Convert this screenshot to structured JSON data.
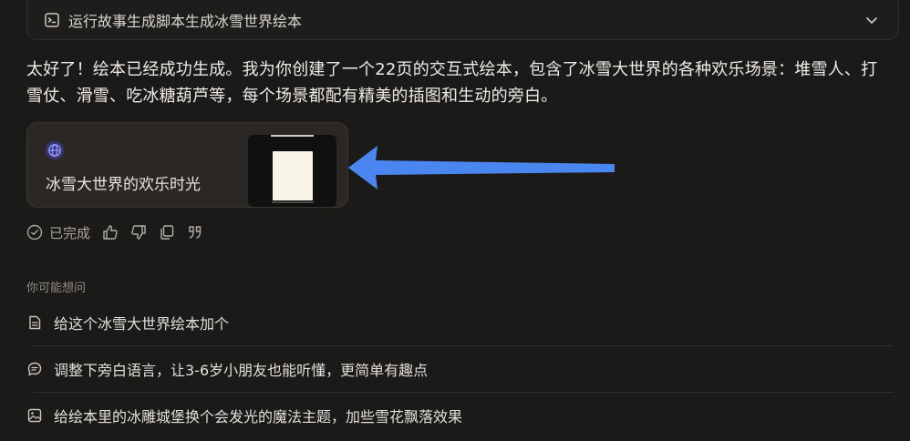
{
  "task": {
    "title": "运行故事生成脚本生成冰雪世界绘本",
    "icon": "terminal-icon",
    "toggle_icon": "chevron-down-icon"
  },
  "message": {
    "text": "太好了！绘本已经成功生成。我为你创建了一个22页的交互式绘本，包含了冰雪大世界的各种欢乐场景：堆雪人、打雪仗、滑雪、吃冰糖葫芦等，每个场景都配有精美的插图和生动的旁白。"
  },
  "card": {
    "title": "冰雪大世界的欢乐时光",
    "icon": "globe-icon",
    "accent": "#6d7cf2",
    "arrow_color": "#4a86f0"
  },
  "status": {
    "label": "已完成",
    "actions": [
      "thumbs-up-icon",
      "thumbs-down-icon",
      "copy-icon",
      "quote-icon"
    ]
  },
  "suggestions": {
    "heading": "你可能想问",
    "items": [
      {
        "text": "给这个冰雪大世界绘本加个",
        "icon": "document-icon"
      },
      {
        "text": "调整下旁白语言，让3-6岁小朋友也能听懂，更简单有趣点",
        "icon": "chat-icon"
      },
      {
        "text": "给绘本里的冰雕城堡换个会发光的魔法主题，加些雪花飘落效果",
        "icon": "image-icon"
      }
    ]
  }
}
